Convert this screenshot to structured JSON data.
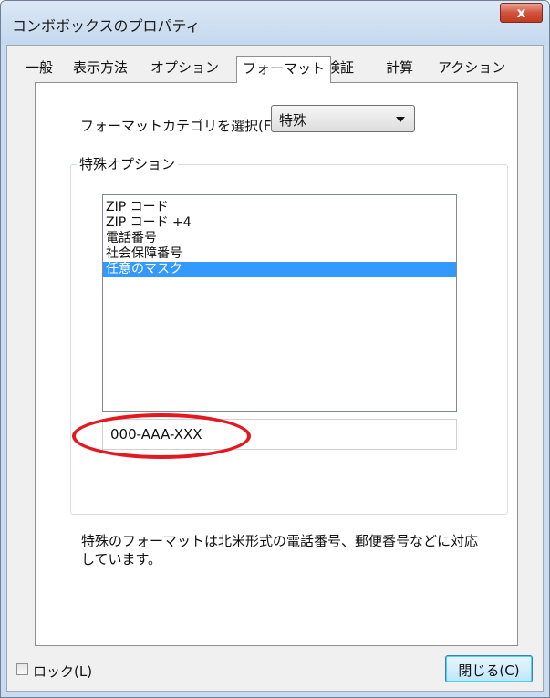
{
  "window": {
    "title": "コンボボックスのプロパティ",
    "close_glyph": "x"
  },
  "tabs": [
    {
      "label": "一般"
    },
    {
      "label": "表示方法"
    },
    {
      "label": "オプション"
    },
    {
      "label": "フォーマット",
      "active": true
    },
    {
      "label": "検証"
    },
    {
      "label": "計算"
    },
    {
      "label": "アクション"
    }
  ],
  "format": {
    "category_label": "フォーマットカテゴリを選択(F):",
    "category_value": "特殊"
  },
  "special_options": {
    "group_label": "特殊オプション",
    "items": [
      {
        "label": "ZIP コード"
      },
      {
        "label": "ZIP コード +4"
      },
      {
        "label": "電話番号"
      },
      {
        "label": "社会保障番号"
      },
      {
        "label": "任意のマスク",
        "selected": true
      }
    ],
    "mask_value": "000-AAA-XXX"
  },
  "description": "特殊のフォーマットは北米形式の電話番号、郵便番号などに対応しています。",
  "footer": {
    "lock_label": "ロック(L)",
    "lock_checked": false,
    "close_label": "閉じる(C)"
  },
  "colors": {
    "selection": "#3399ff",
    "highlight_oval": "#e5171f",
    "window_frame": "#c9dbef"
  }
}
